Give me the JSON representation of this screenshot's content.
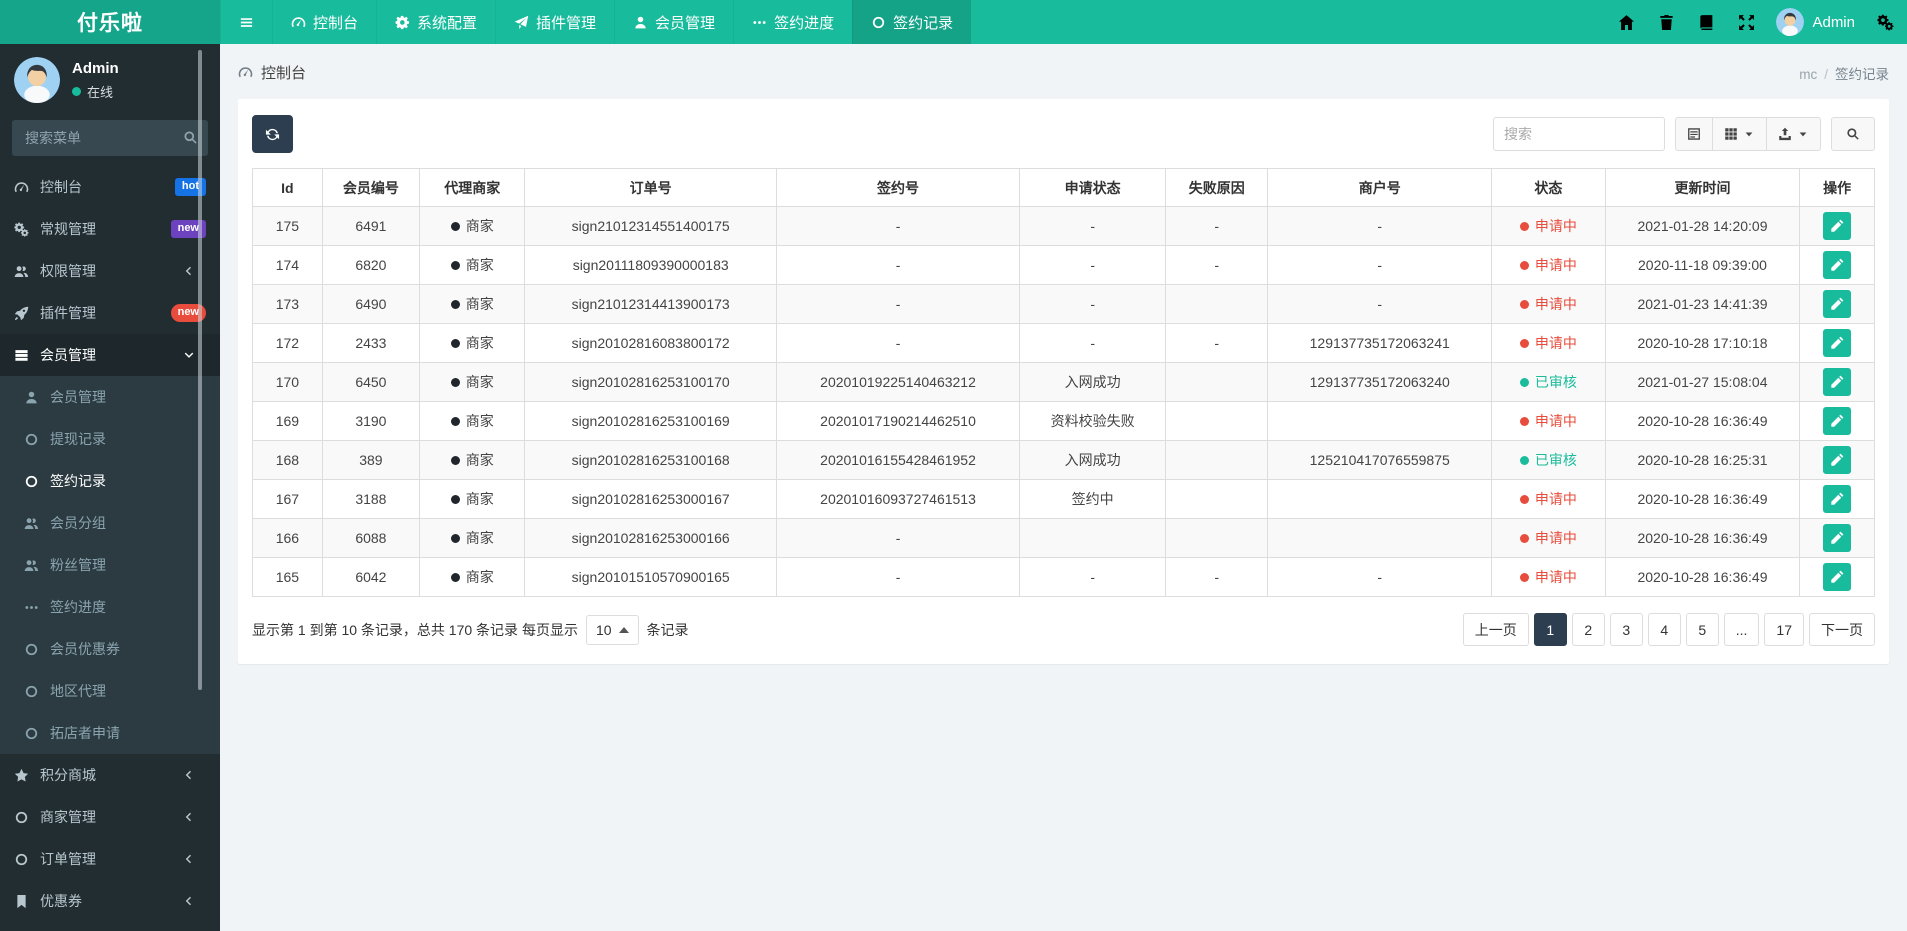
{
  "navbar": {
    "brand": "付乐啦",
    "items": [
      {
        "label": "控制台",
        "icon": "gauge-icon"
      },
      {
        "label": "系统配置",
        "icon": "gear-icon"
      },
      {
        "label": "插件管理",
        "icon": "paper-plane-icon"
      },
      {
        "label": "会员管理",
        "icon": "user-icon"
      },
      {
        "label": "签约进度",
        "icon": "ellipsis-icon"
      },
      {
        "label": "签约记录",
        "icon": "circle-icon",
        "active": true
      }
    ],
    "user_name": "Admin",
    "right_tools": [
      "home-icon",
      "trash-icon",
      "log-icon",
      "fullscreen-icon",
      "avatar",
      "gear-icon"
    ]
  },
  "sidebar": {
    "profile": {
      "name": "Admin",
      "status": "在线"
    },
    "search_placeholder": "搜索菜单",
    "items": [
      {
        "label": "控制台",
        "icon": "gauge-icon",
        "badge": "hot",
        "badge_color": "blue"
      },
      {
        "label": "常规管理",
        "icon": "gears-icon",
        "badge": "new",
        "badge_color": "purple"
      },
      {
        "label": "权限管理",
        "icon": "users-icon",
        "chevron": "left"
      },
      {
        "label": "插件管理",
        "icon": "rocket-icon",
        "badge": "new",
        "badge_color": "red"
      },
      {
        "label": "会员管理",
        "icon": "table-icon",
        "chevron": "down",
        "active": true
      }
    ],
    "submenu": [
      {
        "label": "会员管理",
        "icon": "user-icon"
      },
      {
        "label": "提现记录",
        "icon": "circle-icon"
      },
      {
        "label": "签约记录",
        "icon": "circle-icon",
        "active": true
      },
      {
        "label": "会员分组",
        "icon": "users-icon"
      },
      {
        "label": "粉丝管理",
        "icon": "users-icon"
      },
      {
        "label": "签约进度",
        "icon": "ellipsis-icon"
      },
      {
        "label": "会员优惠券",
        "icon": "circle-icon"
      },
      {
        "label": "地区代理",
        "icon": "circle-icon"
      },
      {
        "label": "拓店者申请",
        "icon": "circle-icon"
      }
    ],
    "items_after": [
      {
        "label": "积分商城",
        "icon": "star-icon",
        "chevron": "left"
      },
      {
        "label": "商家管理",
        "icon": "circle-icon",
        "chevron": "left"
      },
      {
        "label": "订单管理",
        "icon": "circle-icon",
        "chevron": "left"
      },
      {
        "label": "优惠券",
        "icon": "bookmark-icon",
        "chevron": "left"
      }
    ]
  },
  "breadcrumb": {
    "section": "控制台",
    "path_parent": "mc",
    "path_current": "签约记录"
  },
  "toolbar": {
    "search_placeholder": "搜索"
  },
  "table": {
    "columns": [
      "Id",
      "会员编号",
      "代理商家",
      "订单号",
      "签约号",
      "申请状态",
      "失败原因",
      "商户号",
      "状态",
      "更新时间",
      "操作"
    ],
    "rows": [
      {
        "id": "175",
        "member_no": "6491",
        "agent": "商家",
        "order_no": "sign21012314551400175",
        "sign_no": "-",
        "apply_status": "-",
        "fail_reason": "-",
        "merchant_no": "-",
        "status": "申请中",
        "status_color": "red",
        "updated": "2021-01-28 14:20:09"
      },
      {
        "id": "174",
        "member_no": "6820",
        "agent": "商家",
        "order_no": "sign20111809390000183",
        "sign_no": "-",
        "apply_status": "-",
        "fail_reason": "-",
        "merchant_no": "-",
        "status": "申请中",
        "status_color": "red",
        "updated": "2020-11-18 09:39:00"
      },
      {
        "id": "173",
        "member_no": "6490",
        "agent": "商家",
        "order_no": "sign21012314413900173",
        "sign_no": "-",
        "apply_status": "-",
        "fail_reason": "",
        "merchant_no": "-",
        "status": "申请中",
        "status_color": "red",
        "updated": "2021-01-23 14:41:39"
      },
      {
        "id": "172",
        "member_no": "2433",
        "agent": "商家",
        "order_no": "sign20102816083800172",
        "sign_no": "-",
        "apply_status": "-",
        "fail_reason": "-",
        "merchant_no": "129137735172063241",
        "status": "申请中",
        "status_color": "red",
        "updated": "2020-10-28 17:10:18"
      },
      {
        "id": "170",
        "member_no": "6450",
        "agent": "商家",
        "order_no": "sign20102816253100170",
        "sign_no": "20201019225140463212",
        "apply_status": "入网成功",
        "fail_reason": "",
        "merchant_no": "129137735172063240",
        "status": "已审核",
        "status_color": "green",
        "updated": "2021-01-27 15:08:04"
      },
      {
        "id": "169",
        "member_no": "3190",
        "agent": "商家",
        "order_no": "sign20102816253100169",
        "sign_no": "20201017190214462510",
        "apply_status": "资料校验失败",
        "fail_reason": "",
        "merchant_no": "",
        "status": "申请中",
        "status_color": "red",
        "updated": "2020-10-28 16:36:49"
      },
      {
        "id": "168",
        "member_no": "389",
        "agent": "商家",
        "order_no": "sign20102816253100168",
        "sign_no": "20201016155428461952",
        "apply_status": "入网成功",
        "fail_reason": "",
        "merchant_no": "125210417076559875",
        "status": "已审核",
        "status_color": "green",
        "updated": "2020-10-28 16:25:31"
      },
      {
        "id": "167",
        "member_no": "3188",
        "agent": "商家",
        "order_no": "sign20102816253000167",
        "sign_no": "20201016093727461513",
        "apply_status": "签约中",
        "fail_reason": "",
        "merchant_no": "",
        "status": "申请中",
        "status_color": "red",
        "updated": "2020-10-28 16:36:49"
      },
      {
        "id": "166",
        "member_no": "6088",
        "agent": "商家",
        "order_no": "sign20102816253000166",
        "sign_no": "-",
        "apply_status": "",
        "fail_reason": "",
        "merchant_no": "",
        "status": "申请中",
        "status_color": "red",
        "updated": "2020-10-28 16:36:49"
      },
      {
        "id": "165",
        "member_no": "6042",
        "agent": "商家",
        "order_no": "sign20101510570900165",
        "sign_no": "-",
        "apply_status": "-",
        "fail_reason": "-",
        "merchant_no": "-",
        "status": "申请中",
        "status_color": "red",
        "updated": "2020-10-28 16:36:49"
      }
    ]
  },
  "pagination": {
    "info_prefix": "显示第 1 到第 10 条记录，总共 170 条记录 每页显示",
    "page_size": "10",
    "info_suffix": "条记录",
    "pages": [
      "上一页",
      "1",
      "2",
      "3",
      "4",
      "5",
      "...",
      "17",
      "下一页"
    ],
    "active_page": "1"
  },
  "colors": {
    "navbar_green": "#18bc9c",
    "brand_green": "#14a58a",
    "sidebar_dark": "#222d32",
    "submenu_dark": "#2c3b41",
    "primary_navy": "#2c3e50",
    "status_red": "#e74c3c",
    "status_green": "#1abc9c",
    "badge_blue": "#1573e6",
    "badge_purple": "#6c42bf",
    "badge_red": "#e74c3c"
  }
}
